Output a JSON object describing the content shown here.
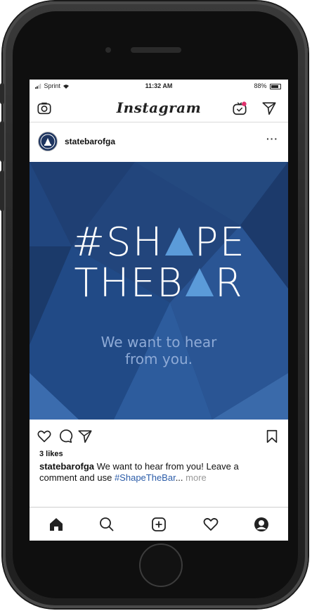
{
  "status_bar": {
    "carrier": "Sprint",
    "time": "11:32 AM",
    "battery": "88%"
  },
  "app": {
    "logo_text": "Instagram"
  },
  "post": {
    "username": "statebarofga",
    "image": {
      "headline_line1_left": "#SH",
      "headline_line1_right": "PE",
      "headline_line2_left": "THEB",
      "headline_line2_right": "R",
      "tagline_line1": "We want to hear",
      "tagline_line2": "from you."
    },
    "likes": "3 likes",
    "caption": {
      "username": "statebarofga",
      "text": " We want to hear from you! Leave a comment and use ",
      "hashtag": "#ShapeTheBar",
      "ellipsis": "...",
      "more": " more"
    }
  },
  "icons": {
    "header": [
      "camera-icon",
      "igtv-icon",
      "direct-message-icon"
    ],
    "actions": [
      "heart-icon",
      "comment-icon",
      "share-icon",
      "bookmark-icon"
    ],
    "tabs": [
      "home-icon",
      "search-icon",
      "new-post-icon",
      "activity-heart-icon",
      "profile-icon"
    ]
  },
  "colors": {
    "post_image_bg": "#21467f",
    "hashtag": "#2b5ca8",
    "igtv_badge": "#e1306c"
  }
}
